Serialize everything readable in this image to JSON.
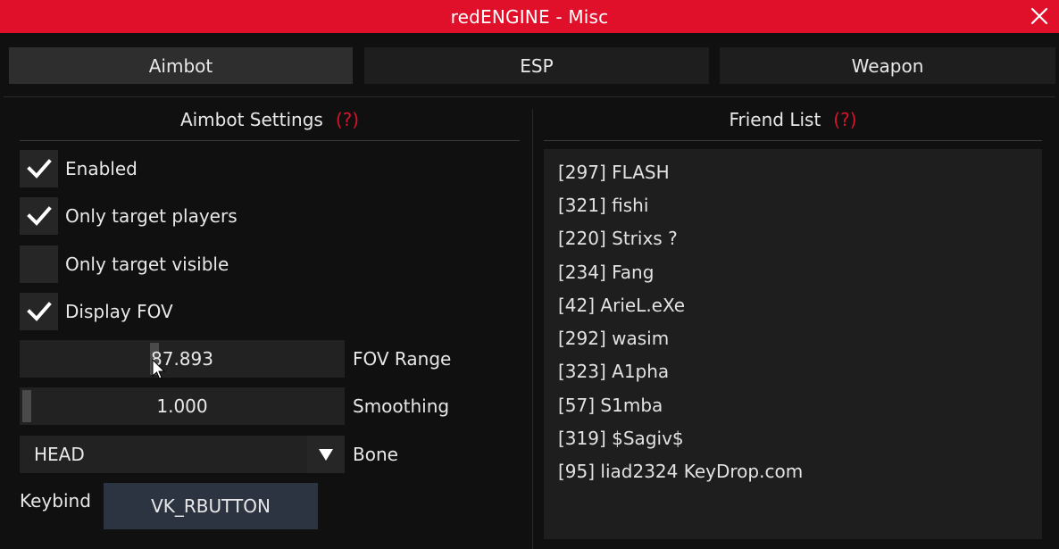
{
  "window": {
    "title": "redENGINE - Misc",
    "accent": "#e0102a",
    "help_color": "#d8142c"
  },
  "tabs": [
    {
      "label": "Aimbot",
      "active": true
    },
    {
      "label": "ESP",
      "active": false
    },
    {
      "label": "Weapon",
      "active": false
    }
  ],
  "aimbot": {
    "title": "Aimbot Settings",
    "help": "(?)",
    "checkboxes": [
      {
        "label": "Enabled",
        "checked": true
      },
      {
        "label": "Only target players",
        "checked": true
      },
      {
        "label": "Only target visible",
        "checked": false
      },
      {
        "label": "Display FOV",
        "checked": true
      }
    ],
    "fov": {
      "value": "87.893",
      "label": "FOV Range"
    },
    "smoothing": {
      "value": "1.000",
      "label": "Smoothing"
    },
    "bone": {
      "value": "HEAD",
      "label": "Bone"
    },
    "keybind": {
      "label": "Keybind",
      "value": "VK_RBUTTON"
    }
  },
  "friends": {
    "title": "Friend List",
    "help": "(?)",
    "items": [
      "[297] FLASH",
      "[321] fishi",
      "[220] Strixs ?",
      "[234] Fang",
      "[42] ArieL.eXe",
      "[292] wasim",
      "[323] A1pha",
      "[57] S1mba",
      "[319] $Sagiv$",
      "[95] liad2324 KeyDrop.com"
    ]
  }
}
